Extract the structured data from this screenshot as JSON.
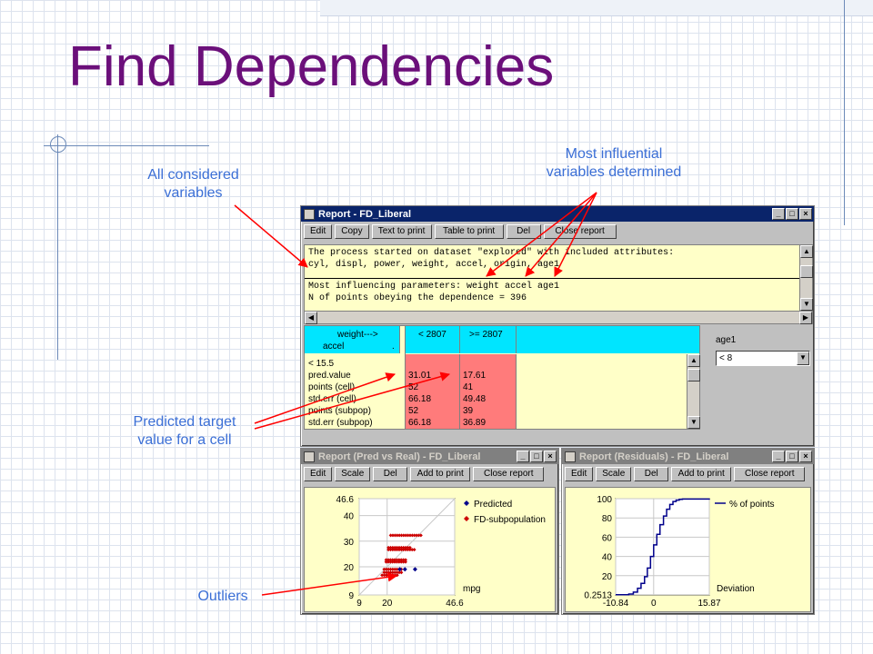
{
  "slide": {
    "title": "Find Dependencies"
  },
  "callouts": {
    "all_vars": [
      "All considered",
      "variables"
    ],
    "influential": [
      "Most influential",
      "variables determined"
    ],
    "predicted": [
      "Predicted target",
      "value  for a cell"
    ],
    "outliers": "Outliers"
  },
  "colors": {
    "title": "#6b0f7a",
    "callout": "#3b6fd6",
    "arrow": "#ff0000",
    "titlebar": "#0a246a",
    "panel": "#ffffc8",
    "header": "#00e5ff",
    "cell": "#ff7b7b"
  },
  "main_window": {
    "title": "Report - FD_Liberal",
    "buttons": [
      "Edit",
      "Copy",
      "Text to print",
      "Table to print",
      "Del",
      "Close report"
    ],
    "text_lines": [
      "The process started on dataset \"explored\" with included attributes:",
      "cyl, displ, power, weight, accel, origin, age1",
      "",
      "Most influencing parameters: weight accel age1",
      "N of points obeying the dependence = 396"
    ],
    "table": {
      "corner": [
        "weight--->",
        "accel"
      ],
      "corner_dot": ".",
      "col_headers": [
        "< 2807",
        ">= 2807"
      ],
      "row_labels": [
        "< 15.5",
        "pred.value",
        "points (cell)",
        "std.err (cell)",
        "points (subpop)",
        "std.err (subpop)"
      ],
      "col1": [
        "31.01",
        "52",
        "66.18",
        "52",
        "66.18"
      ],
      "col2": [
        "17.61",
        "41",
        "49.48",
        "39",
        "36.89"
      ]
    },
    "filter": {
      "label": "age1",
      "value": "< 8"
    }
  },
  "pred_window": {
    "title": "Report (Pred vs Real) - FD_Liberal",
    "buttons": [
      "Edit",
      "Scale",
      "Del",
      "Add to print",
      "Close report"
    ]
  },
  "resid_window": {
    "title": "Report (Residuals) - FD_Liberal",
    "buttons": [
      "Edit",
      "Scale",
      "Del",
      "Add to print",
      "Close report"
    ]
  },
  "chart_data": [
    {
      "type": "scatter",
      "title": "",
      "xlabel": "",
      "ylabel": "",
      "axis_label_inside": "mpg",
      "xlim": [
        9,
        46.6
      ],
      "ylim": [
        9,
        46.6
      ],
      "x_ticks": [
        "9",
        "20",
        "46.6"
      ],
      "y_ticks": [
        "46.6",
        "40",
        "30",
        "20",
        "9"
      ],
      "diagonal": true,
      "legend_position": "top-right",
      "series": [
        {
          "name": "Predicted",
          "color": "#00008b",
          "points": [
            [
              25,
              19
            ],
            [
              27,
              19
            ],
            [
              31,
              19
            ]
          ]
        },
        {
          "name": "FD-subpopulation",
          "color": "#cc0000",
          "points": []
        }
      ],
      "fd_rows": [
        {
          "y": 32.3,
          "x0": 21.4,
          "x1": 33.6
        },
        {
          "y": 27.5,
          "x0": 20.5,
          "x1": 29.7
        },
        {
          "y": 26.7,
          "x0": 20.5,
          "x1": 31.0
        },
        {
          "y": 22.7,
          "x0": 19.6,
          "x1": 27.5
        },
        {
          "y": 21.9,
          "x0": 19.6,
          "x1": 27.5
        },
        {
          "y": 19.0,
          "x0": 18.8,
          "x1": 25.8
        },
        {
          "y": 17.8,
          "x0": 18.8,
          "x1": 25.8
        },
        {
          "y": 16.7,
          "x0": 18.0,
          "x1": 24.5
        }
      ]
    },
    {
      "type": "line",
      "title": "",
      "xlabel": "Deviation",
      "ylabel": "",
      "xlim": [
        -10.84,
        15.87
      ],
      "ylim": [
        0.2513,
        100
      ],
      "x_ticks": [
        "-10.84",
        "0",
        "15.87"
      ],
      "y_ticks": [
        "100",
        "80",
        "60",
        "40",
        "20",
        "0.2513"
      ],
      "legend_position": "top-right",
      "series": [
        {
          "name": "% of points",
          "color": "#00008b",
          "x": [
            -10.84,
            -7.1,
            -5.8,
            -4.6,
            -3.6,
            -2.6,
            -1.8,
            -0.9,
            0,
            0.9,
            1.8,
            2.8,
            3.7,
            4.6,
            5.5,
            6.4,
            7.3,
            8.2,
            15.87
          ],
          "y": [
            0.2513,
            1,
            3,
            7,
            12,
            19,
            28,
            40,
            52,
            63,
            73,
            82,
            89,
            94,
            97,
            98.5,
            99.3,
            99.7,
            100
          ]
        }
      ]
    }
  ]
}
